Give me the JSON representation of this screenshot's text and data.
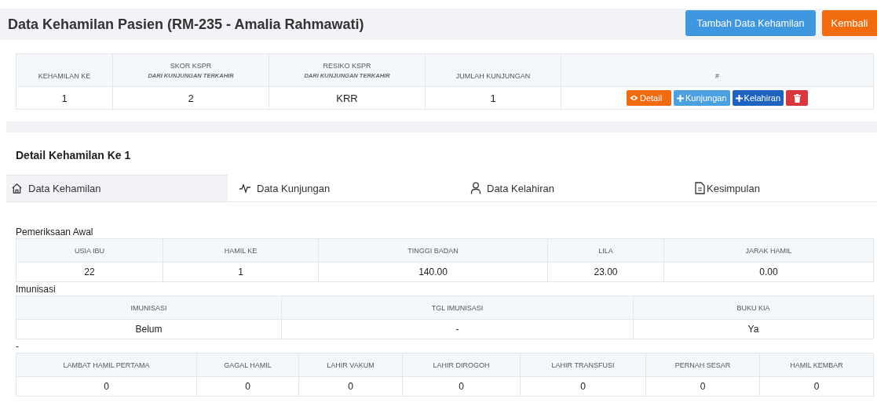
{
  "header": {
    "title": "Data Kehamilan Pasien (RM-235 - Amalia Rahmawati)",
    "buttons": [
      {
        "label": "Tambah Data Kehamilan",
        "kind": "primary"
      },
      {
        "label": "Kembali",
        "kind": "warning"
      }
    ]
  },
  "pregnancy_table": {
    "columns": [
      {
        "label": "KEHAMILAN KE"
      },
      {
        "label": "SKOR KSPR",
        "sublabel": "DARI KUNJUNGAN TERKAHIR"
      },
      {
        "label": "RESIKO KSPR",
        "sublabel": "DARI KUNJUNGAN TERKAHIR"
      },
      {
        "label": "JUMLAH KUNJUNGAN"
      },
      {
        "label": "#"
      }
    ],
    "rows": [
      {
        "cells": [
          "1",
          "2",
          "KRR",
          "1"
        ],
        "actions": [
          {
            "kind": "detail",
            "label": "Detail"
          },
          {
            "kind": "visit",
            "label": "Kunjungan"
          },
          {
            "kind": "birth",
            "label": "Kelahiran"
          },
          {
            "kind": "delete"
          }
        ]
      }
    ]
  },
  "detail": {
    "title": "Detail Kehamilan Ke 1",
    "tabs": [
      {
        "label": "Data Kehamilan",
        "selected": true
      },
      {
        "label": "Data Kunjungan",
        "selected": false
      },
      {
        "label": "Data Kelahiran",
        "selected": false
      },
      {
        "label": "Kesimpulan",
        "selected": false
      }
    ],
    "sections": [
      {
        "title": "Pemeriksaan Awal",
        "columns": [
          "USIA IBU",
          "HAMIL KE",
          "TINGGI BADAN",
          "LILA",
          "JARAK HAMIL"
        ],
        "rows": [
          [
            "22",
            "1",
            "140.00",
            "23.00",
            "0.00"
          ]
        ]
      },
      {
        "title": "Imunisasi",
        "columns": [
          "IMUNISASI",
          "TGL IMUNISASI",
          "BUKU KIA"
        ],
        "rows": [
          [
            "Belum",
            "-",
            "Ya"
          ]
        ]
      },
      {
        "title": "-",
        "columns": [
          "LAMBAT HAMIL PERTAMA",
          "GAGAL HAMIL",
          "LAHIR VAKUM",
          "LAHIR DIROGOH",
          "LAHIR TRANSFUSI",
          "PERNAH SESAR",
          "HAMIL KEMBAR"
        ],
        "rows": [
          [
            "0",
            "0",
            "0",
            "0",
            "0",
            "0",
            "0"
          ]
        ]
      }
    ]
  }
}
